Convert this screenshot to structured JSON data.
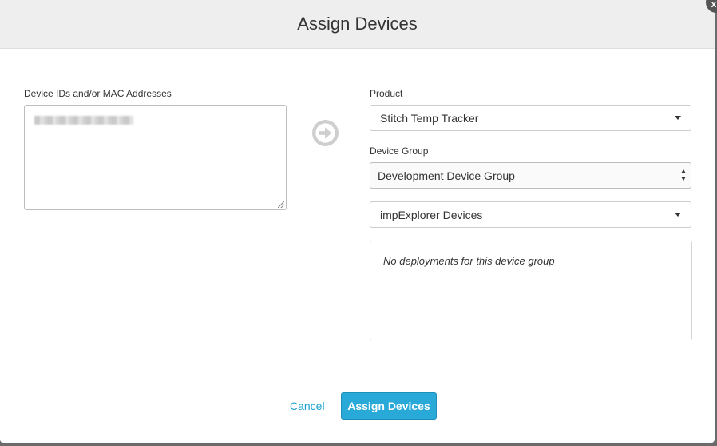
{
  "dialog": {
    "title": "Assign Devices",
    "close_label": "x"
  },
  "left": {
    "ids_label": "Device IDs and/or MAC Addresses"
  },
  "right": {
    "product_label": "Product",
    "product_value": "Stitch Temp Tracker",
    "device_group_label": "Device Group",
    "device_group_value": "Development Device Group",
    "target_value": "impExplorer Devices",
    "deployments_message": "No deployments for this device group"
  },
  "footer": {
    "cancel_label": "Cancel",
    "assign_label": "Assign Devices"
  },
  "colors": {
    "accent": "#29a9d8",
    "link": "#1da1d2",
    "header_bg": "#eeeeee"
  },
  "icons": {
    "arrow": "arrow-right-circle-icon",
    "caret": "caret-down-icon",
    "updown": "select-updown-icon"
  }
}
